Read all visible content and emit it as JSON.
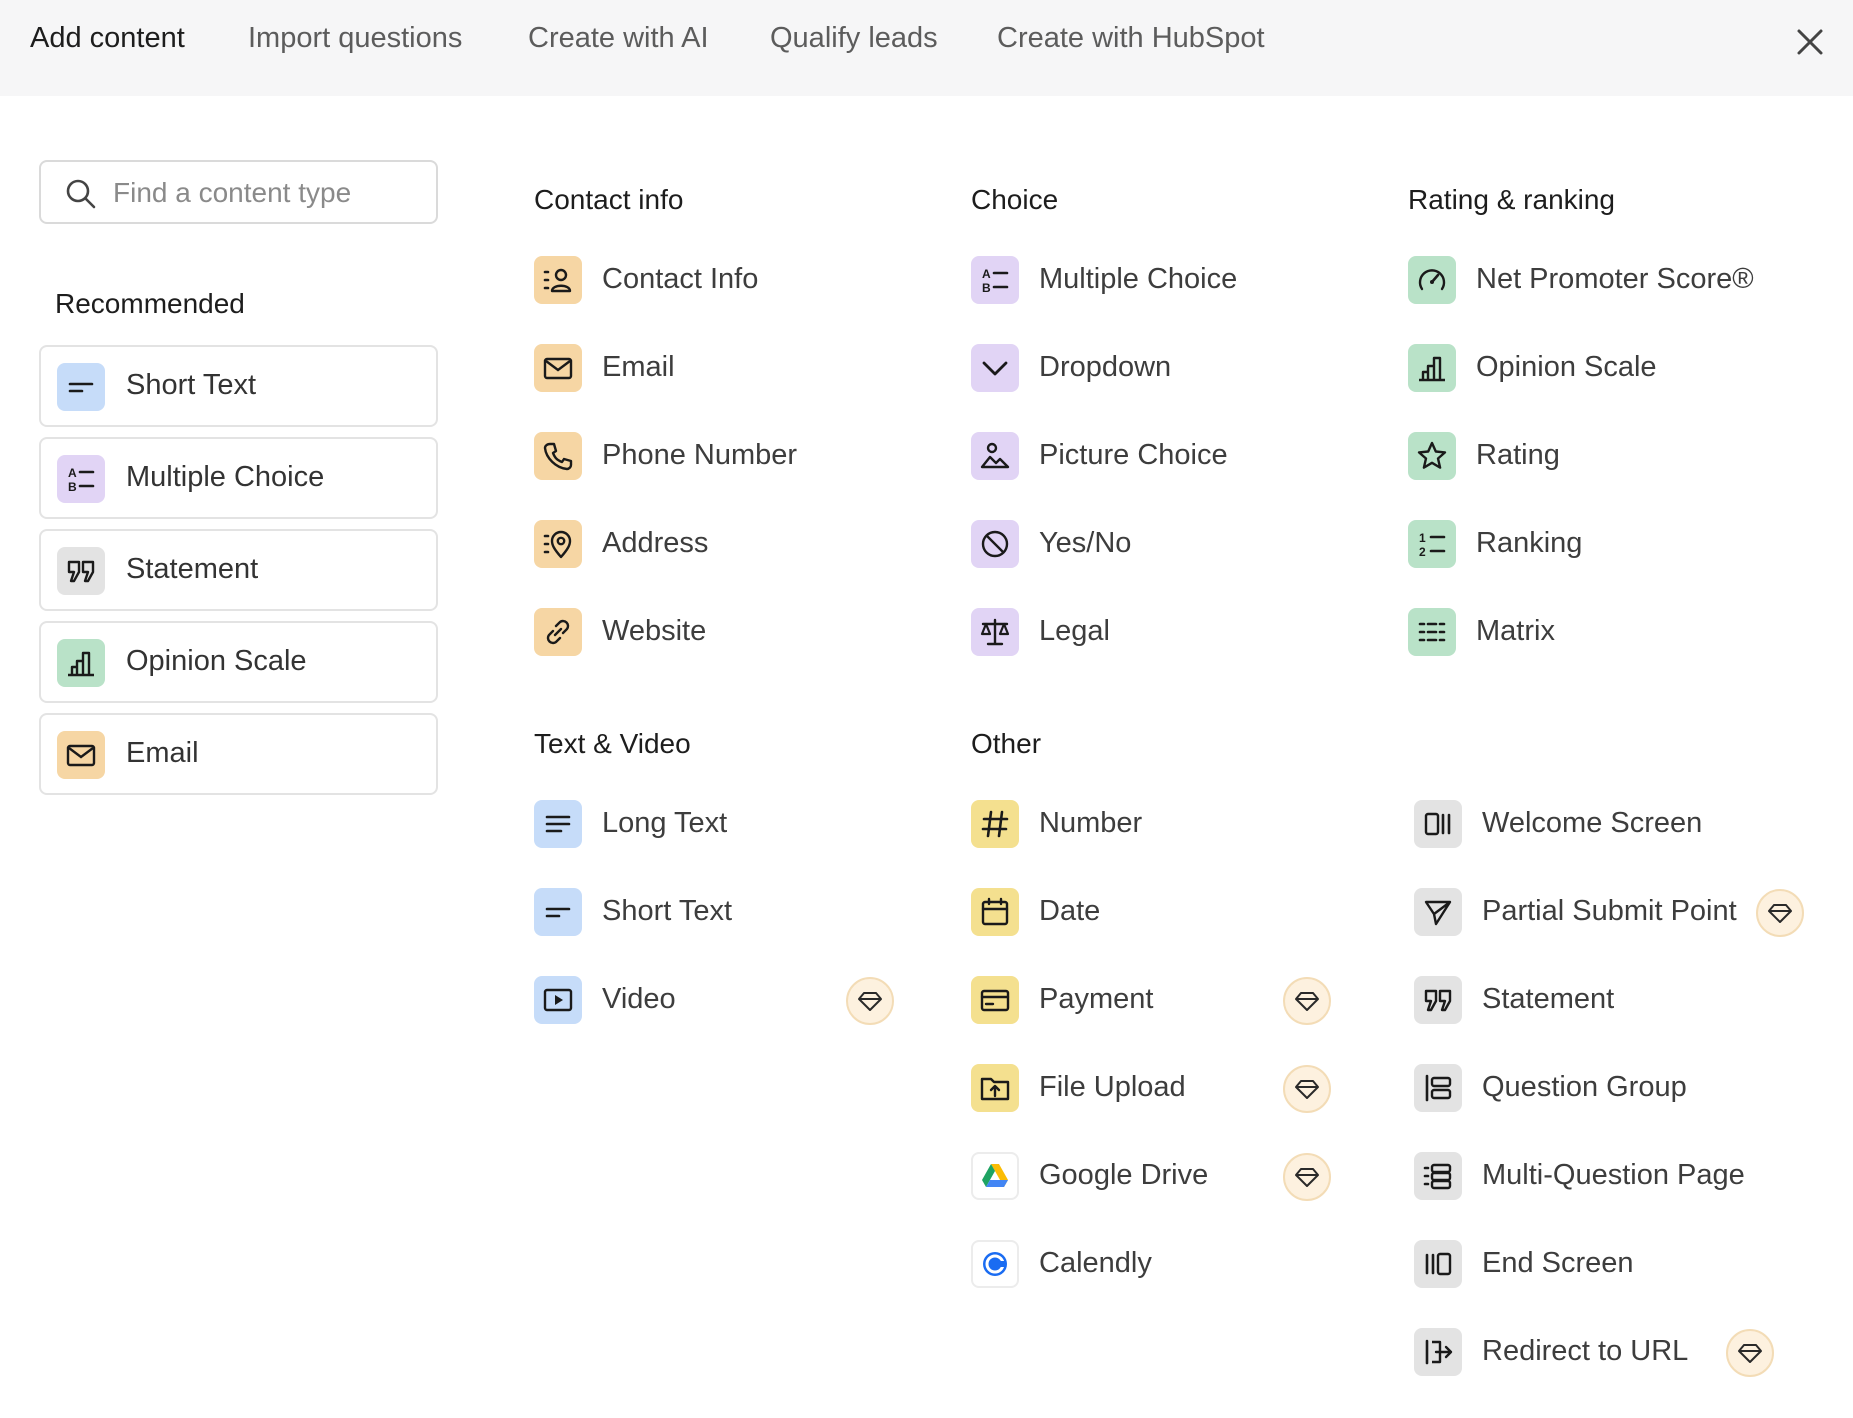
{
  "tabs": [
    {
      "label": "Add content"
    },
    {
      "label": "Import questions"
    },
    {
      "label": "Create with AI"
    },
    {
      "label": "Qualify leads"
    },
    {
      "label": "Create with HubSpot"
    }
  ],
  "close_icon": "close-icon",
  "search": {
    "placeholder": "Find a content type",
    "value": ""
  },
  "recommended": {
    "title": "Recommended",
    "items": [
      {
        "label": "Short Text",
        "icon": "short-text-icon"
      },
      {
        "label": "Multiple Choice",
        "icon": "multiple-choice-icon"
      },
      {
        "label": "Statement",
        "icon": "quote-icon"
      },
      {
        "label": "Opinion Scale",
        "icon": "bar-chart-icon"
      },
      {
        "label": "Email",
        "icon": "envelope-icon"
      }
    ]
  },
  "contact_info": {
    "title": "Contact info",
    "items": [
      {
        "label": "Contact Info",
        "icon": "contact-card-icon"
      },
      {
        "label": "Email",
        "icon": "envelope-icon"
      },
      {
        "label": "Phone Number",
        "icon": "phone-icon"
      },
      {
        "label": "Address",
        "icon": "map-pin-icon"
      },
      {
        "label": "Website",
        "icon": "link-icon"
      }
    ]
  },
  "choice": {
    "title": "Choice",
    "items": [
      {
        "label": "Multiple Choice",
        "icon": "multiple-choice-icon"
      },
      {
        "label": "Dropdown",
        "icon": "chevron-down-icon"
      },
      {
        "label": "Picture Choice",
        "icon": "picture-icon"
      },
      {
        "label": "Yes/No",
        "icon": "yes-no-icon"
      },
      {
        "label": "Legal",
        "icon": "scales-icon"
      }
    ]
  },
  "rating": {
    "title": "Rating & ranking",
    "items": [
      {
        "label": "Net Promoter Score®",
        "icon": "gauge-icon"
      },
      {
        "label": "Opinion Scale",
        "icon": "bar-chart-icon"
      },
      {
        "label": "Rating",
        "icon": "star-icon"
      },
      {
        "label": "Ranking",
        "icon": "ranking-icon"
      },
      {
        "label": "Matrix",
        "icon": "matrix-icon"
      }
    ]
  },
  "text_video": {
    "title": "Text & Video",
    "items": [
      {
        "label": "Long Text",
        "icon": "long-text-icon"
      },
      {
        "label": "Short Text",
        "icon": "short-text-icon"
      },
      {
        "label": "Video",
        "icon": "video-icon",
        "premium": true
      }
    ]
  },
  "other": {
    "title": "Other",
    "items": [
      {
        "label": "Number",
        "icon": "hash-icon"
      },
      {
        "label": "Date",
        "icon": "calendar-icon"
      },
      {
        "label": "Payment",
        "icon": "credit-card-icon",
        "premium": true
      },
      {
        "label": "File Upload",
        "icon": "file-upload-icon",
        "premium": true
      },
      {
        "label": "Google Drive",
        "icon": "google-drive-icon",
        "premium": true
      },
      {
        "label": "Calendly",
        "icon": "calendly-icon"
      }
    ]
  },
  "screens": {
    "items": [
      {
        "label": "Welcome Screen",
        "icon": "welcome-screen-icon"
      },
      {
        "label": "Partial Submit Point",
        "icon": "send-icon",
        "premium": true
      },
      {
        "label": "Statement",
        "icon": "quote-icon"
      },
      {
        "label": "Question Group",
        "icon": "question-group-icon"
      },
      {
        "label": "Multi-Question Page",
        "icon": "multi-question-icon"
      },
      {
        "label": "End Screen",
        "icon": "end-screen-icon"
      },
      {
        "label": "Redirect to URL",
        "icon": "redirect-icon",
        "premium": true
      }
    ]
  },
  "premium_icon": "diamond-icon",
  "colors": {
    "blue": "#c6dcf9",
    "purple": "#e1d4f5",
    "orange": "#f6d6a4",
    "green": "#b9e2c8",
    "yellow": "#f4e08f",
    "gray": "#e3e3e3",
    "premium_bg": "#fdf1df"
  }
}
